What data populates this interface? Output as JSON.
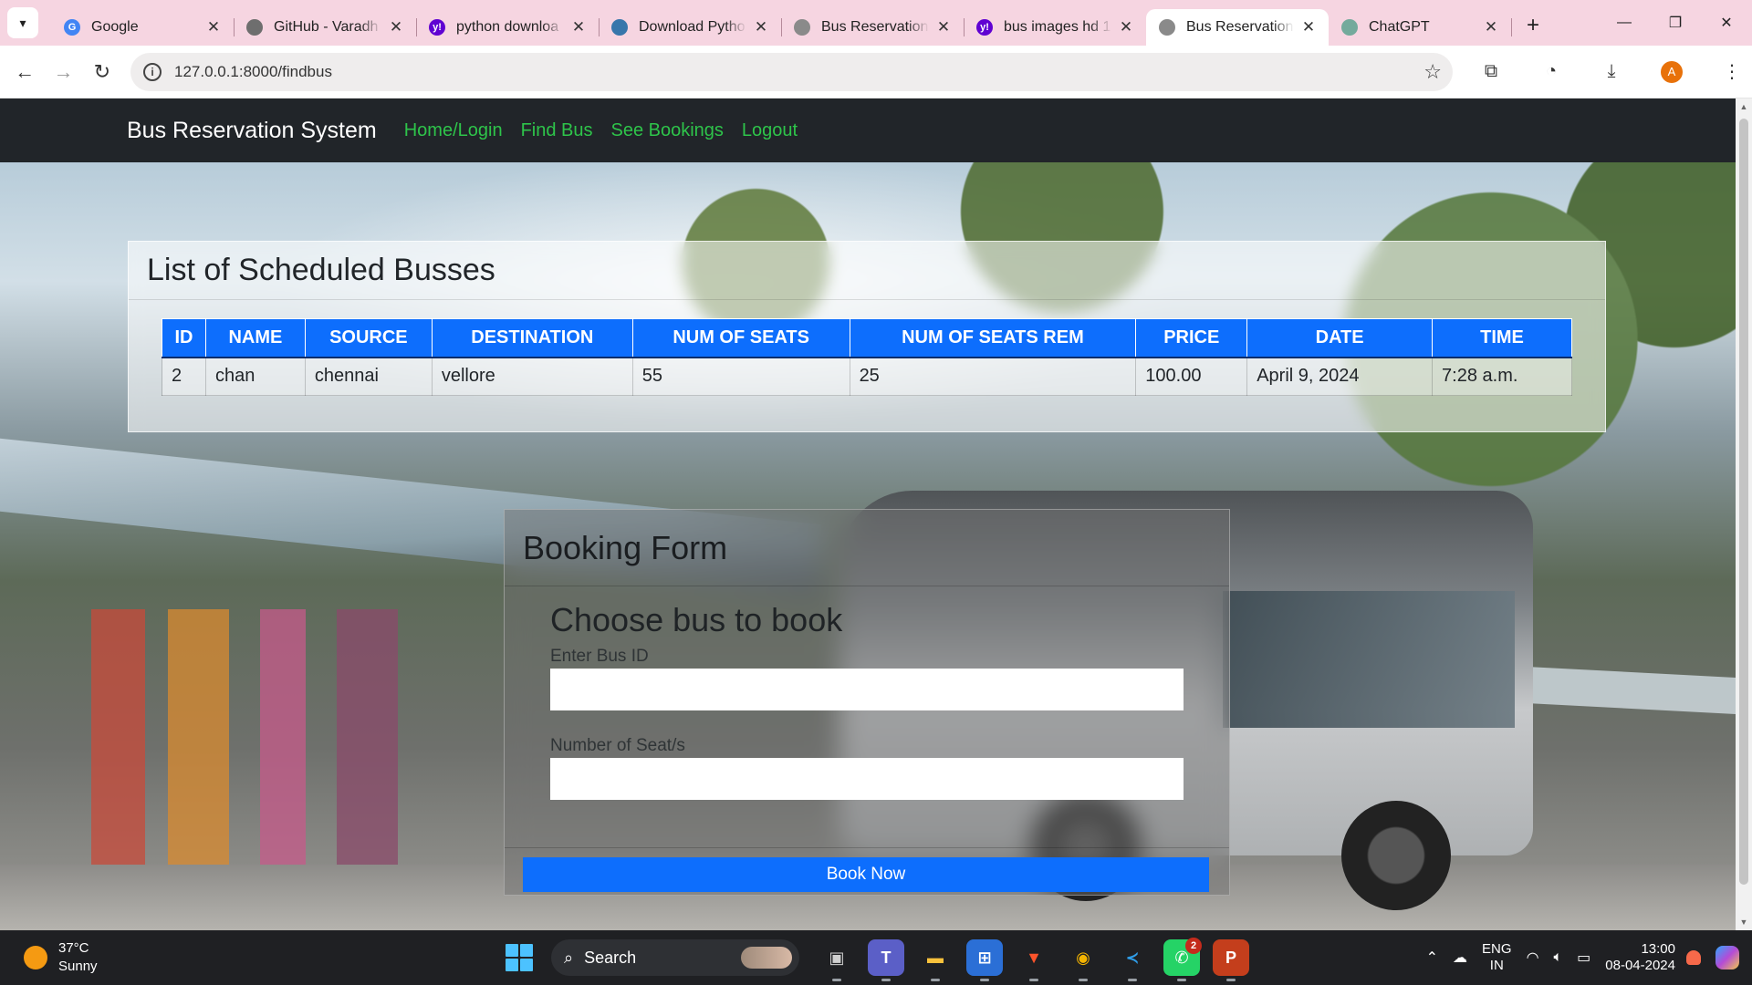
{
  "browser": {
    "tab_menu_icon": "chevron-down-icon",
    "tabs": [
      {
        "title": "Google",
        "favicon": "google-icon",
        "color": "#4285f4",
        "glyph": "G",
        "active": false
      },
      {
        "title": "GitHub - Varadh",
        "favicon": "github-icon",
        "color": "#6e6e6e",
        "glyph": "",
        "active": false
      },
      {
        "title": "python downloa",
        "favicon": "yahoo-icon",
        "color": "#6001d2",
        "glyph": "y!",
        "active": false
      },
      {
        "title": "Download Pytho",
        "favicon": "python-icon",
        "color": "#3776ab",
        "glyph": "",
        "active": false
      },
      {
        "title": "Bus Reservation",
        "favicon": "globe-icon",
        "color": "#8a8a8a",
        "glyph": "",
        "active": false
      },
      {
        "title": "bus images hd 1",
        "favicon": "yahoo-icon",
        "color": "#6001d2",
        "glyph": "y!",
        "active": false
      },
      {
        "title": "Bus Reservation",
        "favicon": "globe-icon",
        "color": "#8a8a8a",
        "glyph": "",
        "active": true
      },
      {
        "title": "ChatGPT",
        "favicon": "chatgpt-icon",
        "color": "#74aa9c",
        "glyph": "",
        "active": false
      }
    ],
    "url": "127.0.0.1:8000/findbus",
    "profile_initial": "A"
  },
  "navbar": {
    "brand": "Bus Reservation System",
    "links": [
      "Home/Login",
      "Find Bus",
      "See Bookings",
      "Logout"
    ]
  },
  "bus_list": {
    "title": "List of Scheduled Busses",
    "columns": [
      "ID",
      "NAME",
      "SOURCE",
      "DESTINATION",
      "NUM OF SEATS",
      "NUM OF SEATS REM",
      "PRICE",
      "DATE",
      "TIME"
    ],
    "rows": [
      [
        "2",
        "chan",
        "chennai",
        "vellore",
        "55",
        "25",
        "100.00",
        "April 9, 2024",
        "7:28 a.m."
      ]
    ]
  },
  "booking_form": {
    "header": "Booking Form",
    "title": "Choose bus to book",
    "bus_id_label": "Enter Bus ID",
    "bus_id_value": "",
    "seats_label": "Number of Seat/s",
    "seats_value": "",
    "submit_label": "Book Now"
  },
  "taskbar": {
    "temperature": "37°C",
    "condition": "Sunny",
    "search_label": "Search",
    "apps": [
      {
        "name": "task-view-icon",
        "glyph": "▣",
        "color": "#d0d0d0",
        "bg": "transparent",
        "badge": ""
      },
      {
        "name": "teams-icon",
        "glyph": "T",
        "color": "#ffffff",
        "bg": "#5b5fc7",
        "badge": ""
      },
      {
        "name": "file-explorer-icon",
        "glyph": "▬",
        "color": "#f9c23c",
        "bg": "transparent",
        "badge": ""
      },
      {
        "name": "microsoft-store-icon",
        "glyph": "⊞",
        "color": "#ffffff",
        "bg": "#2b6fd6",
        "badge": ""
      },
      {
        "name": "brave-icon",
        "glyph": "▼",
        "color": "#fb542b",
        "bg": "transparent",
        "badge": ""
      },
      {
        "name": "chrome-icon",
        "glyph": "◉",
        "color": "#f4b400",
        "bg": "transparent",
        "badge": ""
      },
      {
        "name": "vscode-icon",
        "glyph": "≺",
        "color": "#2f9de8",
        "bg": "transparent",
        "badge": ""
      },
      {
        "name": "whatsapp-icon",
        "glyph": "✆",
        "color": "#ffffff",
        "bg": "#25d366",
        "badge": "2"
      },
      {
        "name": "powerpoint-icon",
        "glyph": "P",
        "color": "#ffffff",
        "bg": "#c43e1c",
        "badge": ""
      }
    ],
    "lang_line1": "ENG",
    "lang_line2": "IN",
    "time": "13:00",
    "date": "08-04-2024"
  }
}
